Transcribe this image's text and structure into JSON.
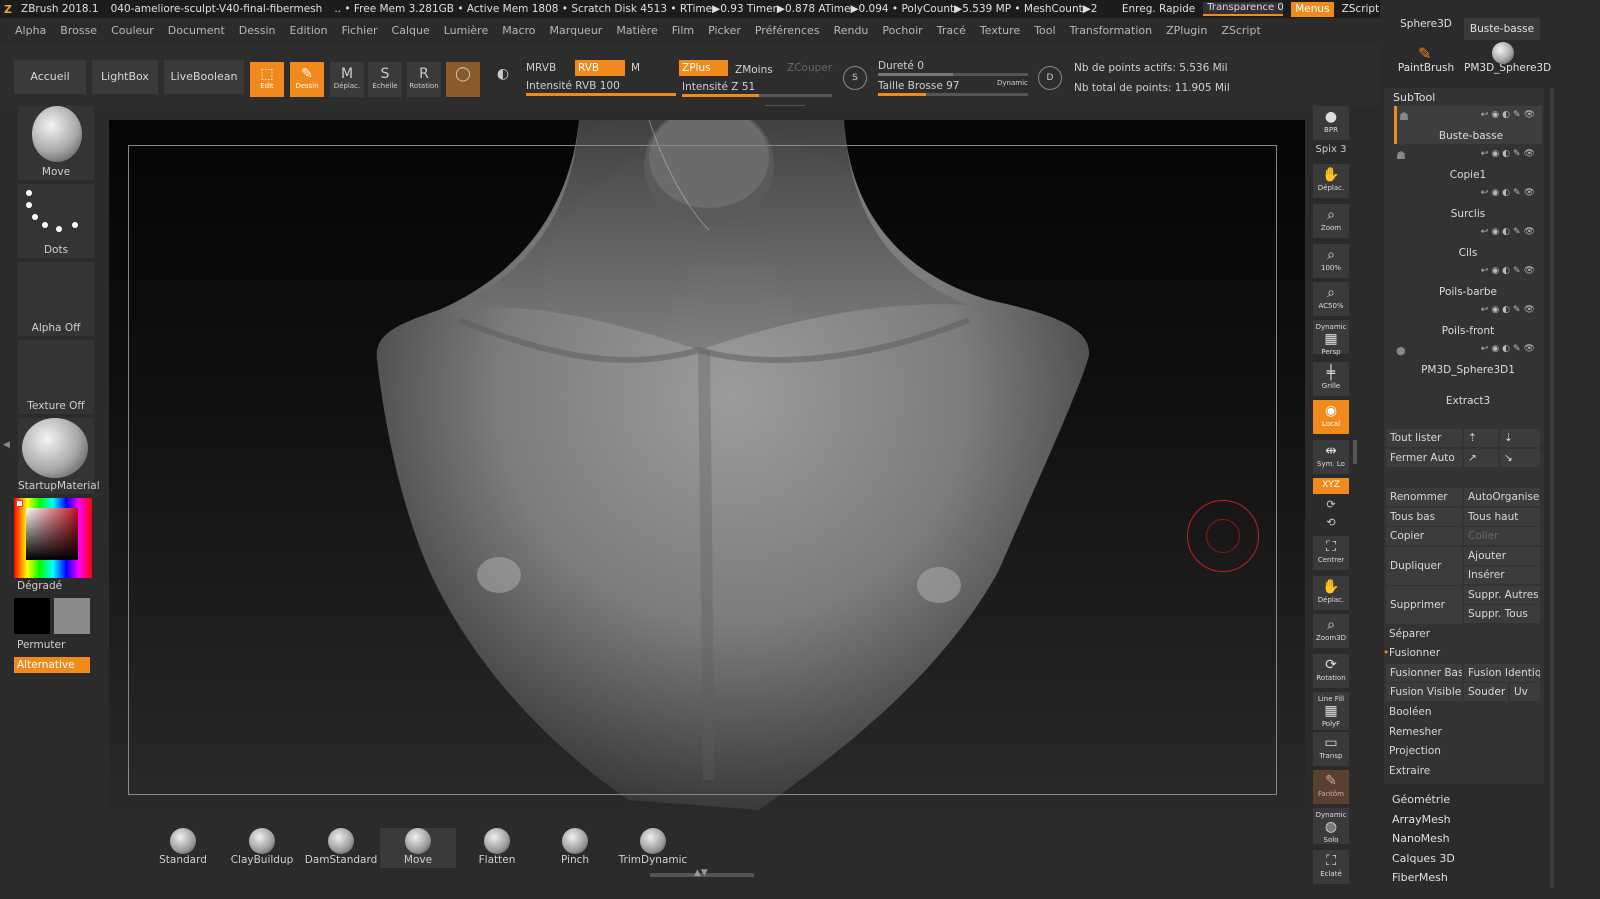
{
  "titlebar": {
    "app": "ZBrush 2018.1",
    "file": "040-ameliore-sculpt-V40-final-fibermesh",
    "stats": ".. • Free Mem 3.281GB • Active Mem 1808 • Scratch Disk 4513 • RTime▶0.93 Timer▶0.878 ATime▶0.094 • PolyCount▶5.539 MP • MeshCount▶2",
    "quicksave": "Enreg. Rapide",
    "transparency": "Transparence 0",
    "menus": "Menus",
    "zscript": "ZScript Défaut"
  },
  "menubar": [
    "Alpha",
    "Brosse",
    "Couleur",
    "Document",
    "Dessin",
    "Edition",
    "Fichier",
    "Calque",
    "Lumière",
    "Macro",
    "Marqueur",
    "Matière",
    "Film",
    "Picker",
    "Préférences",
    "Rendu",
    "Pochoir",
    "Tracé",
    "Texture",
    "Tool",
    "Transformation",
    "ZPlugin",
    "ZScript"
  ],
  "toolbar": {
    "tabs": [
      "Accueil",
      "LightBox",
      "LiveBoolean"
    ],
    "tools": [
      {
        "label": "Edit",
        "icon": "edit-icon",
        "on": true
      },
      {
        "label": "Dessin",
        "icon": "draw-icon",
        "on": true
      },
      {
        "label": "Déplac.",
        "icon": "move-icon",
        "on": false
      },
      {
        "label": "Echelle",
        "icon": "scale-icon",
        "on": false
      },
      {
        "label": "Rotation",
        "icon": "rotate-icon",
        "on": false
      }
    ],
    "mrvb": "MRVB",
    "rvb": "RVB",
    "m": "M",
    "rvb_intensity": "Intensité RVB 100",
    "zplus": "ZPlus",
    "zmoins": "ZMoins",
    "zcouper": "ZCouper",
    "z_intensity": "Intensité Z 51",
    "hardness": "Dureté 0",
    "brush_size": "Taille Brosse 97",
    "dynamic": "Dynamic",
    "s_label": "S",
    "d_label": "D",
    "active_points": "Nb de points actifs: 5.536 Mil",
    "total_points": "Nb total de points: 11.905 Mil"
  },
  "leftshelf": {
    "brush": "Move",
    "stroke": "Dots",
    "alpha": "Alpha Off",
    "texture": "Texture Off",
    "material": "StartupMaterial",
    "gradient": "Dégradé",
    "swap": "Permuter",
    "alternative": "Alternative"
  },
  "brushes": [
    "Standard",
    "ClayBuildup",
    "DamStandard",
    "Move",
    "Flatten",
    "Pinch",
    "TrimDynamic"
  ],
  "rightshelf": {
    "bpr": "BPR",
    "spix": "Spix 3",
    "scroll": "Déplac.",
    "zoom": "Zoom",
    "actual": "100%",
    "aahalf": "AC50%",
    "dynamic": "Dynamic",
    "persp": "Persp",
    "floor": "Grille",
    "local": "Local",
    "symlo": "Sym. Lo",
    "xyz": "XYZ",
    "frame": "Centrer",
    "move": "Déplac.",
    "zoom3d": "Zoom3D",
    "rotate": "Rotation",
    "linefill": "Line Fill",
    "polyf": "PolyF",
    "transp": "Transp",
    "ghost": "Fantôm",
    "solo_dynamic": "Dynamic",
    "solo": "Solo",
    "explode": "Eclaté"
  },
  "rightpanel": {
    "tools": [
      "Sphere3D",
      "Buste-basse",
      "PaintBrush",
      "PM3D_Sphere3D"
    ],
    "subtool_title": "SubTool",
    "subtools": [
      "Buste-basse",
      "Copie1",
      "Surclis",
      "Cils",
      "Poils-barbe",
      "Poils-front",
      "PM3D_Sphere3D1",
      "Extract3"
    ],
    "list_all": "Tout lister",
    "auto_collapse": "Fermer Auto",
    "rename": "Renommer",
    "autoreorder": "AutoOrganiser",
    "all_low": "Tous bas",
    "all_high": "Tous haut",
    "copy": "Copier",
    "paste": "Coller",
    "duplicate": "Dupliquer",
    "append": "Ajouter",
    "insert": "Insérer",
    "delete": "Supprimer",
    "del_other": "Suppr. Autres",
    "del_all": "Suppr. Tous",
    "split": "Séparer",
    "merge": "Fusionner",
    "merge_down": "Fusionner Bas",
    "merge_similar": "Fusion Identique",
    "merge_visible": "Fusion Visible",
    "weld": "Souder",
    "uv": "Uv",
    "boolean": "Booléen",
    "remesh": "Remesher",
    "project": "Projection",
    "extract": "Extraire",
    "geometry": "Géométrie",
    "arraymesh": "ArrayMesh",
    "nanomesh": "NanoMesh",
    "layers": "Calques 3D",
    "fibermesh": "FiberMesh"
  },
  "colors": {
    "accent": "#f08a1c",
    "panel": "#2b2b2b",
    "button": "#3a3a3a"
  }
}
